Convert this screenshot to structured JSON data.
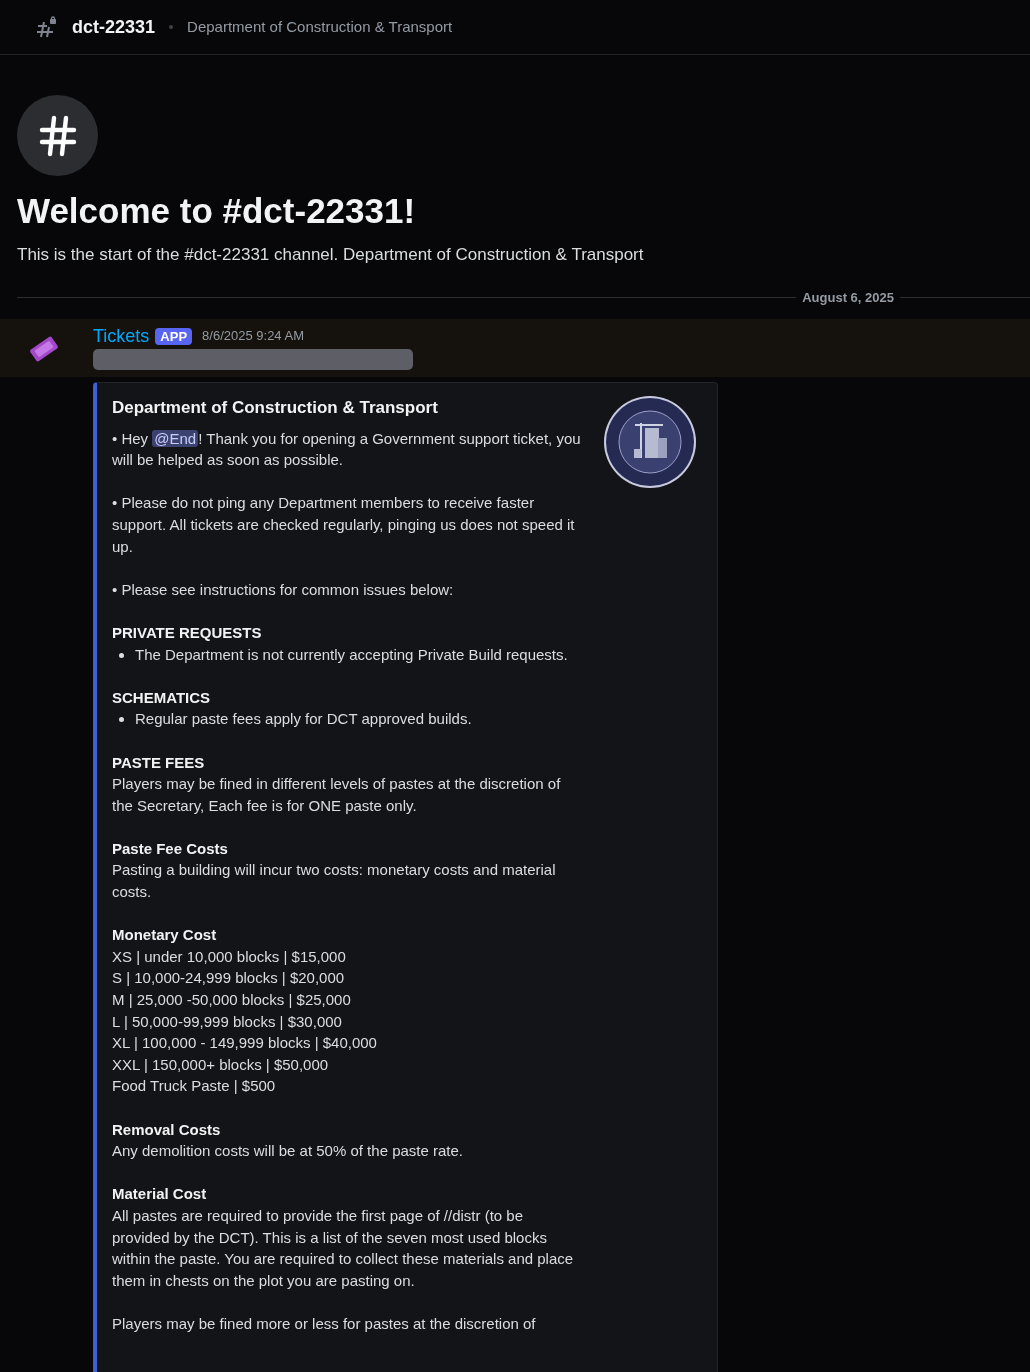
{
  "header": {
    "channel": "dct-22331",
    "topic": "Department of Construction & Transport"
  },
  "welcome": {
    "title": "Welcome to #dct-22331!",
    "subtitle": "This is the start of the #dct-22331 channel. Department of Construction & Transport"
  },
  "date_divider": "August 6, 2025",
  "message": {
    "author": "Tickets",
    "badge": "APP",
    "timestamp": "8/6/2025 9:24 AM",
    "embed": {
      "title": "Department of Construction & Transport",
      "groups": [
        [
          {
            "kind": "mention",
            "before": "• Hey ",
            "mention": "@End",
            "after": "! Thank you for opening a Government support ticket, you will be helped as soon as possible."
          }
        ],
        [
          {
            "kind": "text",
            "text": "• Please do not ping any Department members to receive faster support. All tickets are checked regularly, pinging us does not speed it up."
          }
        ],
        [
          {
            "kind": "text",
            "text": "• Please see instructions for common issues below:"
          }
        ],
        [
          {
            "kind": "heading",
            "text": "PRIVATE REQUESTS"
          },
          {
            "kind": "bullet",
            "text": "The Department is not currently accepting Private Build requests."
          }
        ],
        [
          {
            "kind": "heading",
            "text": "SCHEMATICS"
          },
          {
            "kind": "bullet",
            "text": "Regular paste fees apply for DCT approved builds."
          }
        ],
        [
          {
            "kind": "heading",
            "text": "PASTE FEES"
          },
          {
            "kind": "text",
            "text": "Players may be fined in different levels of pastes at the discretion of the Secretary, Each fee is for ONE paste only."
          }
        ],
        [
          {
            "kind": "heading",
            "text": "Paste Fee Costs"
          },
          {
            "kind": "text",
            "text": "Pasting a building will incur two costs: monetary costs and material costs."
          }
        ],
        [
          {
            "kind": "heading",
            "text": "Monetary Cost"
          },
          {
            "kind": "text",
            "text": "XS | under 10,000 blocks | $15,000"
          },
          {
            "kind": "text",
            "text": "S | 10,000-24,999 blocks | $20,000"
          },
          {
            "kind": "text",
            "text": "M | 25,000 -50,000 blocks | $25,000"
          },
          {
            "kind": "text",
            "text": "L | 50,000-99,999 blocks | $30,000"
          },
          {
            "kind": "text",
            "text": "XL | 100,000 - 149,999 blocks | $40,000"
          },
          {
            "kind": "text",
            "text": "XXL | 150,000+ blocks | $50,000"
          },
          {
            "kind": "text",
            "text": "Food Truck Paste | $500"
          }
        ],
        [
          {
            "kind": "heading",
            "text": "Removal Costs"
          },
          {
            "kind": "text",
            "text": "Any demolition costs will be at 50% of the paste rate."
          }
        ],
        [
          {
            "kind": "heading",
            "text": "Material Cost"
          },
          {
            "kind": "text",
            "text": "All pastes are required to provide the first page of //distr (to be provided by the DCT). This is a list of the seven most used blocks within the paste. You are required to collect these materials and place them in chests on the plot you are pasting on."
          }
        ],
        [
          {
            "kind": "text",
            "text": "Players may be fined more or less for pastes at the discretion of"
          }
        ]
      ]
    }
  }
}
